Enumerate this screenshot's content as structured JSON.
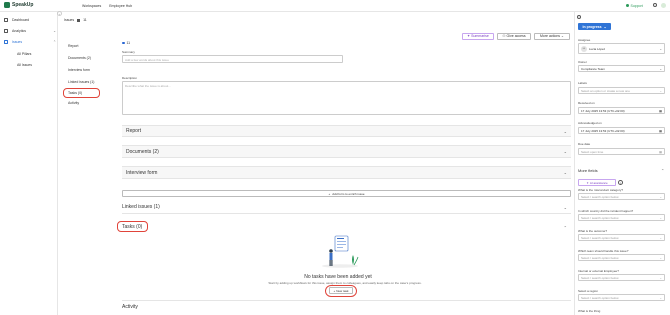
{
  "app": {
    "logo_text": "SpeakUp",
    "nav": [
      "Workspaces",
      "Employee Hub"
    ],
    "support_label": "Support"
  },
  "sidebar": {
    "items": [
      {
        "label": "Dashboard",
        "icon": "dashboard-icon"
      },
      {
        "label": "Analytics",
        "icon": "analytics-icon",
        "chevron": "⌄"
      },
      {
        "label": "Issues",
        "icon": "issues-icon",
        "chevron": "⌃",
        "active": true
      }
    ],
    "sub_items": [
      "All Pillars",
      "All Issues"
    ]
  },
  "issue": {
    "crumb_label": "Issues",
    "id": "11"
  },
  "inner_nav": [
    "Report",
    "Documents (2)",
    "Interview form",
    "Linked issues (1)",
    "Tasks (0)",
    "Activity"
  ],
  "toolbar": {
    "summarise": "Summarise",
    "give_access": "Give access",
    "more_actions": "More actions"
  },
  "form": {
    "summary_label": "Summary",
    "summary_placeholder": "Add a few words about this issue",
    "description_label": "Description",
    "description_placeholder": "Describe what the issue is about..."
  },
  "sections": {
    "report": "Report",
    "documents": "Documents (2)",
    "interview_form": "Interview form",
    "add_form": "Add form to enrich issue",
    "linked_issues": "Linked issues (1)",
    "tasks": "Tasks (0)",
    "activity": "Activity"
  },
  "tasks_empty": {
    "title": "No tasks have been added yet",
    "subtitle": "Start by adding up workflows for this issue, assign them to colleagues, and easily keep tabs on the case's progress.",
    "new_task": "New task"
  },
  "right_panel": {
    "status": "In progress",
    "assignee_label": "Assignee",
    "assignee_value": "Lucia López",
    "assignee_initials": "LL",
    "owner_label": "Owner",
    "owner_value": "Compliance Team",
    "labels_label": "Labels",
    "labels_placeholder": "Select an option or create a new one",
    "received_label": "Received on",
    "received_value": "17 July 2025 13:53 (UTC+02:00)",
    "acknowledged_label": "Acknowledged on",
    "acknowledged_value": "17 July 2025 13:53 (UTC+02:00)",
    "due_label": "Due date",
    "due_placeholder": "Select open time",
    "more_fields": "More fields",
    "ai_button": "AI assistance",
    "fields": [
      {
        "label": "What is the misconduct category?",
        "placeholder": "Select / search option below"
      },
      {
        "label": "In which country did the incident happen?",
        "placeholder": "Select / search option below"
      },
      {
        "label": "What is the outcome?",
        "placeholder": "Select / search option below"
      },
      {
        "label": "Which team should handle this issue?",
        "placeholder": "Select / search option below"
      },
      {
        "label": "Internal or external Employee?",
        "placeholder": "Select / search option below"
      },
      {
        "label": "Select a region",
        "placeholder": "Select / search option below"
      },
      {
        "label": "What is the thing",
        "placeholder": ""
      }
    ]
  },
  "colors": {
    "brand": "#1f7a4c",
    "primary": "#2f74d6",
    "highlight_ring": "#e0443a",
    "ai_purple": "#7b3fc4"
  }
}
